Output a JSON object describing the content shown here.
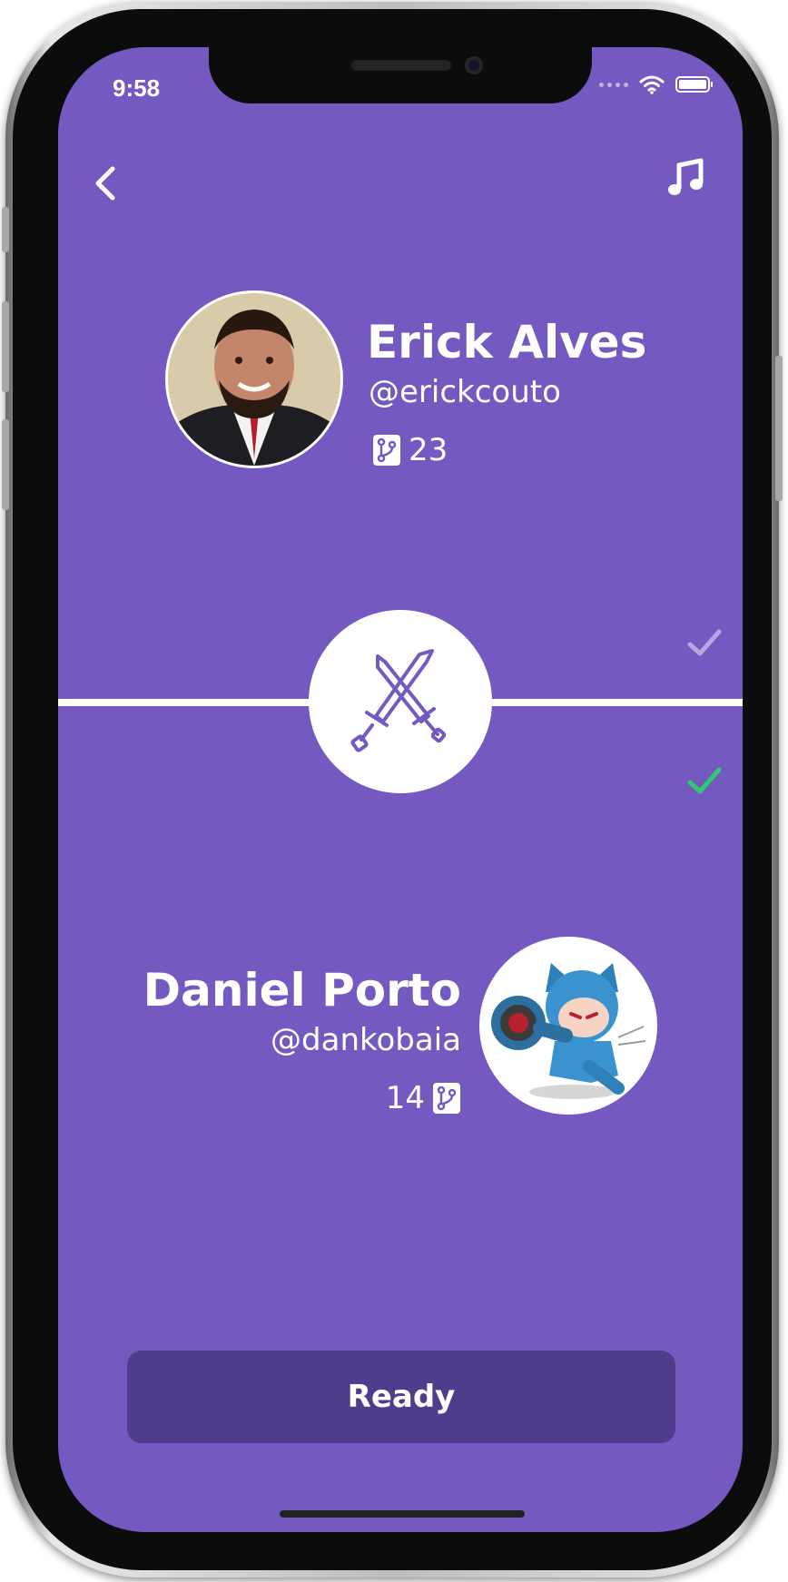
{
  "status_bar": {
    "time": "9:58"
  },
  "opponents": [
    {
      "name": "Erick Alves",
      "handle": "@erickcouto",
      "count": "23"
    },
    {
      "name": "Daniel Porto",
      "handle": "@dankobaia",
      "count": "14"
    }
  ],
  "ready_button": {
    "label": "Ready"
  },
  "colors": {
    "background": "#7459c1",
    "button": "#4f3c8a",
    "check_done": "#2ecc71",
    "check_pending": "#b7a9e0"
  },
  "icons": {
    "back": "chevron-left-icon",
    "music": "music-note-icon",
    "repo": "git-branch-icon",
    "battle": "crossed-swords-icon",
    "check": "checkmark-icon"
  }
}
